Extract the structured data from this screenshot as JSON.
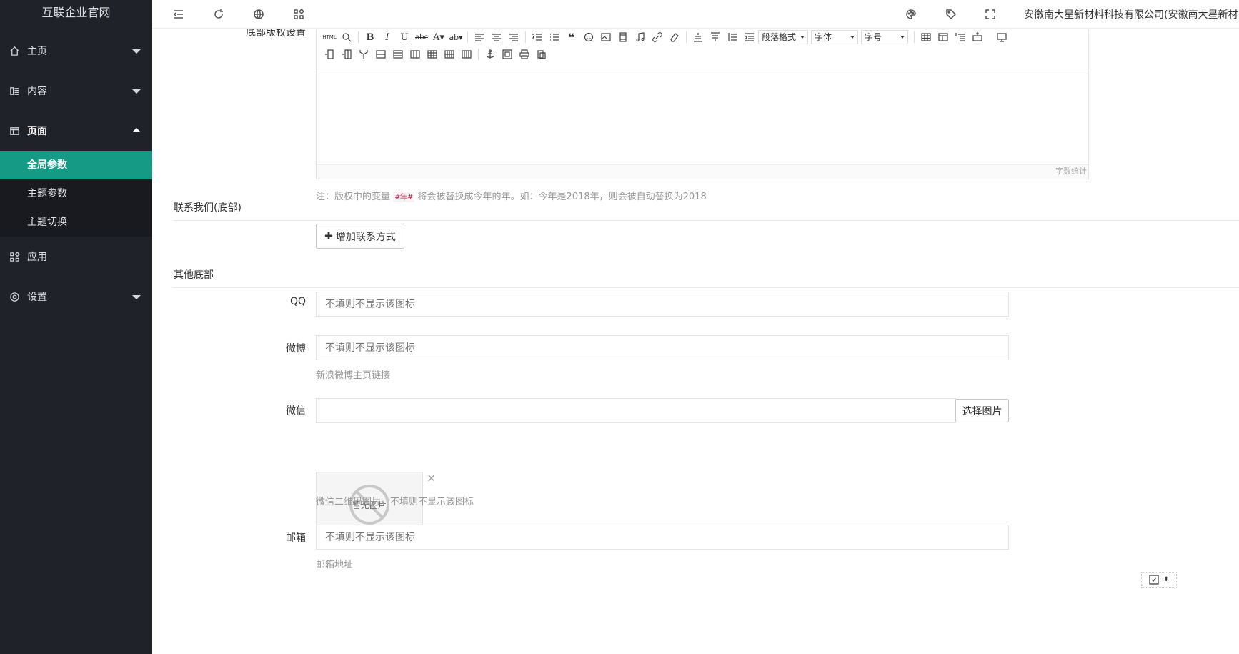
{
  "app": {
    "title": "互联企业官网"
  },
  "sidebar": {
    "items": [
      {
        "label": "主页",
        "icon": "home-icon"
      },
      {
        "label": "内容",
        "icon": "content-icon"
      },
      {
        "label": "页面",
        "icon": "page-icon"
      },
      {
        "label": "应用",
        "icon": "apps-icon"
      },
      {
        "label": "设置",
        "icon": "gear-icon"
      }
    ],
    "subitems": [
      {
        "label": "全局参数"
      },
      {
        "label": "主题参数"
      },
      {
        "label": "主题切换"
      }
    ]
  },
  "topbar": {
    "company": "安徽南大星新材料科技有限公司(安徽南大星新材"
  },
  "editor": {
    "label": "底部版权设置",
    "html_btn": "HTML",
    "para_select": "段落格式",
    "font_select": "字体",
    "size_select": "字号",
    "word_count": "字数统计"
  },
  "note": {
    "prefix": "注：版权中的变量",
    "var": "#年#",
    "suffix": "将会被替换成今年的年。如：今年是2018年，则会被自动替换为2018"
  },
  "contact": {
    "section_title": "联系我们(底部)",
    "add_button": "增加联系方式"
  },
  "other": {
    "section_title": "其他底部",
    "qq_label": "QQ",
    "qq_placeholder": "不填则不显示该图标",
    "weibo_label": "微博",
    "weibo_placeholder": "不填则不显示该图标",
    "weibo_help": "新浪微博主页链接",
    "wechat_label": "微信",
    "wechat_select_button": "选择图片",
    "wechat_no_image": "暂无图片",
    "wechat_help": "微信二维码图片，不填则不显示该图标",
    "email_label": "邮箱",
    "email_placeholder": "不填则不显示该图标",
    "email_help": "邮箱地址"
  },
  "colors": {
    "sidebar_bg": "#20222a",
    "accent": "#159a86"
  }
}
